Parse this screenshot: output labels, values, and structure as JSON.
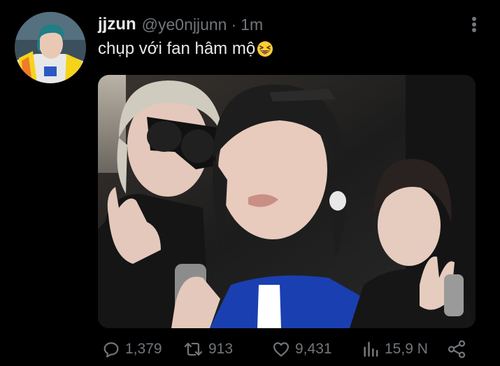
{
  "tweet": {
    "display_name": "jjzun",
    "handle": "@ye0njjunn",
    "separator": "·",
    "time": "1m",
    "text": "chụp với fan hâm mộ",
    "text_emoji": "grinning-squinting-face-icon"
  },
  "metrics": {
    "replies": "1,379",
    "retweets": "913",
    "likes": "9,431",
    "views": "15,9 N"
  },
  "icons": {
    "more": "more-vertical-icon",
    "reply": "reply-icon",
    "retweet": "retweet-icon",
    "like": "heart-icon",
    "views": "views-icon",
    "share": "share-icon"
  },
  "colors": {
    "background": "#000000",
    "primary_text": "#e7e9ea",
    "secondary_text": "#71767b"
  }
}
